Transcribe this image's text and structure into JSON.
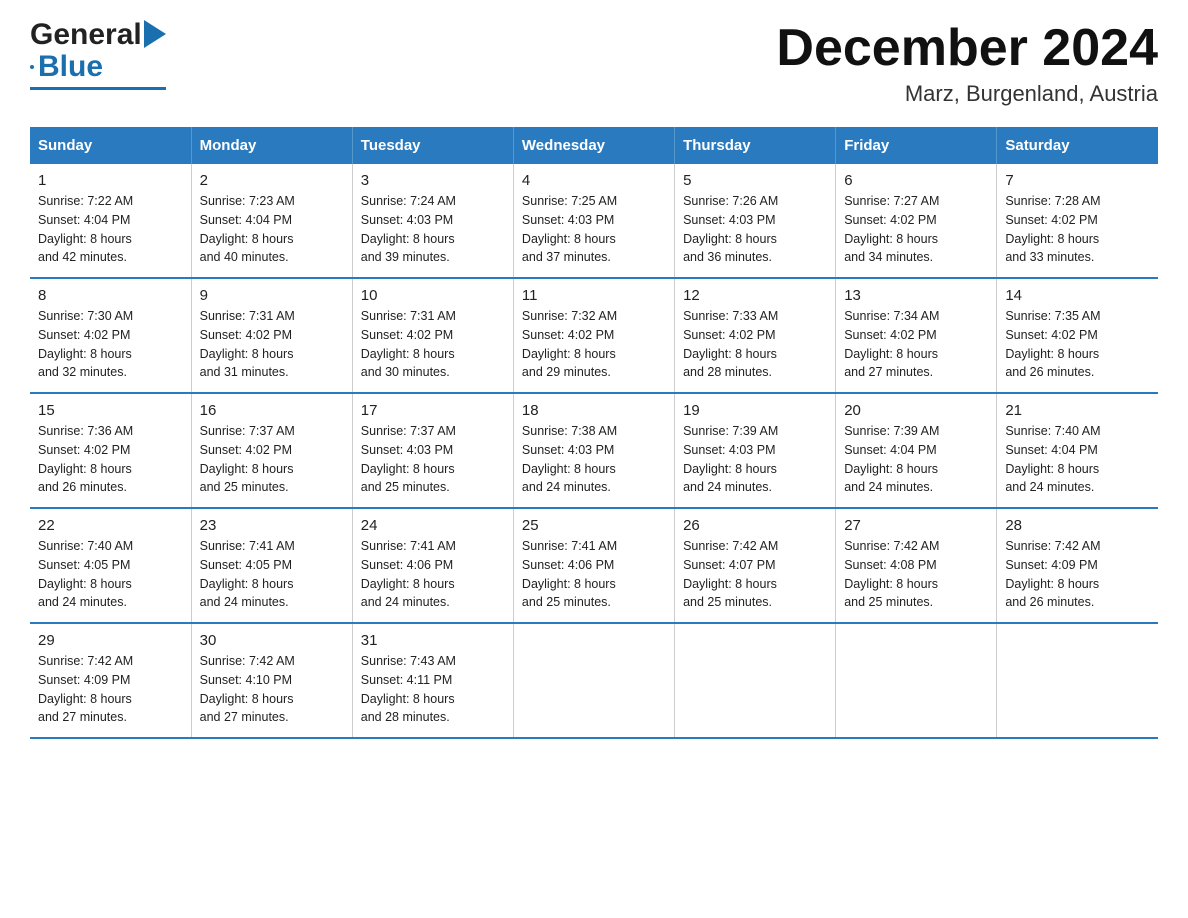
{
  "logo": {
    "text_general": "General",
    "text_blue": "Blue",
    "arrow": "▶"
  },
  "title": "December 2024",
  "subtitle": "Marz, Burgenland, Austria",
  "weekdays": [
    "Sunday",
    "Monday",
    "Tuesday",
    "Wednesday",
    "Thursday",
    "Friday",
    "Saturday"
  ],
  "weeks": [
    [
      {
        "day": "1",
        "sunrise": "7:22 AM",
        "sunset": "4:04 PM",
        "daylight": "8 hours and 42 minutes."
      },
      {
        "day": "2",
        "sunrise": "7:23 AM",
        "sunset": "4:04 PM",
        "daylight": "8 hours and 40 minutes."
      },
      {
        "day": "3",
        "sunrise": "7:24 AM",
        "sunset": "4:03 PM",
        "daylight": "8 hours and 39 minutes."
      },
      {
        "day": "4",
        "sunrise": "7:25 AM",
        "sunset": "4:03 PM",
        "daylight": "8 hours and 37 minutes."
      },
      {
        "day": "5",
        "sunrise": "7:26 AM",
        "sunset": "4:03 PM",
        "daylight": "8 hours and 36 minutes."
      },
      {
        "day": "6",
        "sunrise": "7:27 AM",
        "sunset": "4:02 PM",
        "daylight": "8 hours and 34 minutes."
      },
      {
        "day": "7",
        "sunrise": "7:28 AM",
        "sunset": "4:02 PM",
        "daylight": "8 hours and 33 minutes."
      }
    ],
    [
      {
        "day": "8",
        "sunrise": "7:30 AM",
        "sunset": "4:02 PM",
        "daylight": "8 hours and 32 minutes."
      },
      {
        "day": "9",
        "sunrise": "7:31 AM",
        "sunset": "4:02 PM",
        "daylight": "8 hours and 31 minutes."
      },
      {
        "day": "10",
        "sunrise": "7:31 AM",
        "sunset": "4:02 PM",
        "daylight": "8 hours and 30 minutes."
      },
      {
        "day": "11",
        "sunrise": "7:32 AM",
        "sunset": "4:02 PM",
        "daylight": "8 hours and 29 minutes."
      },
      {
        "day": "12",
        "sunrise": "7:33 AM",
        "sunset": "4:02 PM",
        "daylight": "8 hours and 28 minutes."
      },
      {
        "day": "13",
        "sunrise": "7:34 AM",
        "sunset": "4:02 PM",
        "daylight": "8 hours and 27 minutes."
      },
      {
        "day": "14",
        "sunrise": "7:35 AM",
        "sunset": "4:02 PM",
        "daylight": "8 hours and 26 minutes."
      }
    ],
    [
      {
        "day": "15",
        "sunrise": "7:36 AM",
        "sunset": "4:02 PM",
        "daylight": "8 hours and 26 minutes."
      },
      {
        "day": "16",
        "sunrise": "7:37 AM",
        "sunset": "4:02 PM",
        "daylight": "8 hours and 25 minutes."
      },
      {
        "day": "17",
        "sunrise": "7:37 AM",
        "sunset": "4:03 PM",
        "daylight": "8 hours and 25 minutes."
      },
      {
        "day": "18",
        "sunrise": "7:38 AM",
        "sunset": "4:03 PM",
        "daylight": "8 hours and 24 minutes."
      },
      {
        "day": "19",
        "sunrise": "7:39 AM",
        "sunset": "4:03 PM",
        "daylight": "8 hours and 24 minutes."
      },
      {
        "day": "20",
        "sunrise": "7:39 AM",
        "sunset": "4:04 PM",
        "daylight": "8 hours and 24 minutes."
      },
      {
        "day": "21",
        "sunrise": "7:40 AM",
        "sunset": "4:04 PM",
        "daylight": "8 hours and 24 minutes."
      }
    ],
    [
      {
        "day": "22",
        "sunrise": "7:40 AM",
        "sunset": "4:05 PM",
        "daylight": "8 hours and 24 minutes."
      },
      {
        "day": "23",
        "sunrise": "7:41 AM",
        "sunset": "4:05 PM",
        "daylight": "8 hours and 24 minutes."
      },
      {
        "day": "24",
        "sunrise": "7:41 AM",
        "sunset": "4:06 PM",
        "daylight": "8 hours and 24 minutes."
      },
      {
        "day": "25",
        "sunrise": "7:41 AM",
        "sunset": "4:06 PM",
        "daylight": "8 hours and 25 minutes."
      },
      {
        "day": "26",
        "sunrise": "7:42 AM",
        "sunset": "4:07 PM",
        "daylight": "8 hours and 25 minutes."
      },
      {
        "day": "27",
        "sunrise": "7:42 AM",
        "sunset": "4:08 PM",
        "daylight": "8 hours and 25 minutes."
      },
      {
        "day": "28",
        "sunrise": "7:42 AM",
        "sunset": "4:09 PM",
        "daylight": "8 hours and 26 minutes."
      }
    ],
    [
      {
        "day": "29",
        "sunrise": "7:42 AM",
        "sunset": "4:09 PM",
        "daylight": "8 hours and 27 minutes."
      },
      {
        "day": "30",
        "sunrise": "7:42 AM",
        "sunset": "4:10 PM",
        "daylight": "8 hours and 27 minutes."
      },
      {
        "day": "31",
        "sunrise": "7:43 AM",
        "sunset": "4:11 PM",
        "daylight": "8 hours and 28 minutes."
      },
      null,
      null,
      null,
      null
    ]
  ],
  "labels": {
    "sunrise": "Sunrise:",
    "sunset": "Sunset:",
    "daylight": "Daylight:"
  }
}
